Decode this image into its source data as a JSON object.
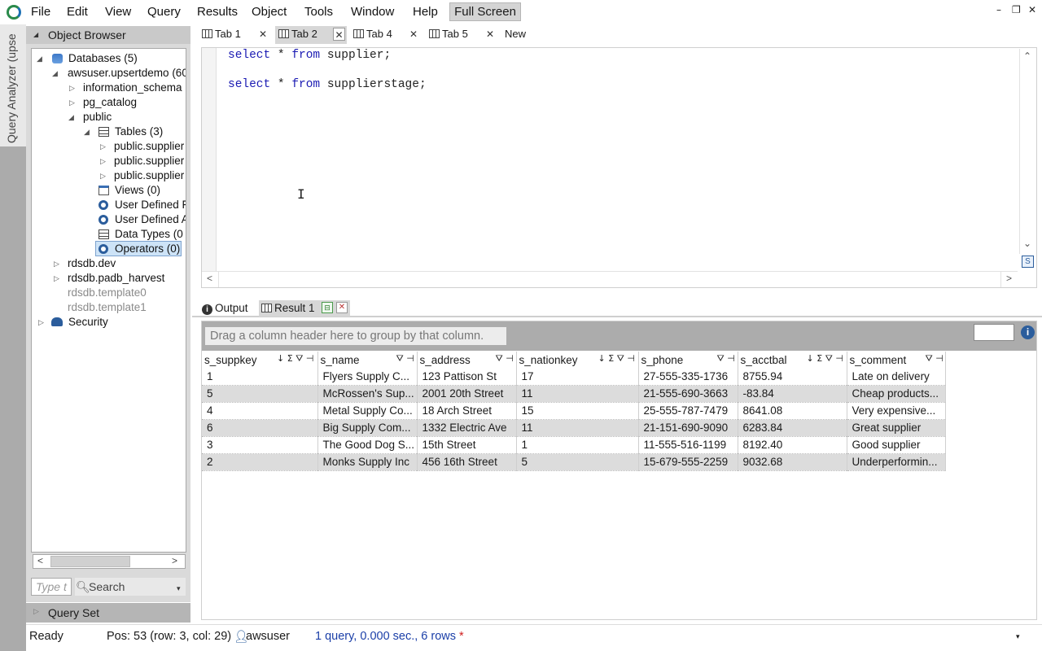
{
  "menu": [
    "File",
    "Edit",
    "View",
    "Query",
    "Results",
    "Object",
    "Tools",
    "Window",
    "Help"
  ],
  "fullscreen_label": "Full Screen",
  "rail_label": "Query Analyzer (upse",
  "object_browser": {
    "title": "Object Browser",
    "tree": {
      "databases": "Databases (5)",
      "awsuser_db": "awsuser.upsertdemo (60",
      "information_schema": "information_schema",
      "pg_catalog": "pg_catalog",
      "public": "public",
      "tables": "Tables (3)",
      "table_items": [
        "public.supplier",
        "public.supplier",
        "public.supplier"
      ],
      "views": "Views (0)",
      "udf": "User Defined F",
      "uda": "User Defined A",
      "data_types": "Data Types (0",
      "operators": "Operators (0)",
      "rdsdb_dev": "rdsdb.dev",
      "rdsdb_padb": "rdsdb.padb_harvest",
      "template0": "rdsdb.template0",
      "template1": "rdsdb.template1",
      "security": "Security"
    },
    "filter_placeholder": "Type t",
    "search_label": "Search"
  },
  "query_set_label": "Query Set",
  "tabs": [
    {
      "label": "Tab 1"
    },
    {
      "label": "Tab 2"
    },
    {
      "label": "Tab 4"
    },
    {
      "label": "Tab 5"
    },
    {
      "label": "New"
    }
  ],
  "editor": {
    "line1": {
      "kw1": "select",
      "rest1": " * ",
      "kw2": "from",
      "rest2": " supplier;"
    },
    "line3": {
      "kw1": "select",
      "rest1": " * ",
      "kw2": "from",
      "rest2": " supplierstage;"
    }
  },
  "result_tabs": {
    "output": "Output",
    "result1": "Result 1"
  },
  "group_hint": "Drag a column header here to group by that column.",
  "columns": [
    "s_suppkey",
    "s_name",
    "s_address",
    "s_nationkey",
    "s_phone",
    "s_acctbal",
    "s_comment"
  ],
  "rows": [
    [
      "1",
      "Flyers Supply C...",
      "123 Pattison St",
      "17",
      "27-555-335-1736",
      "8755.94",
      "Late on delivery"
    ],
    [
      "5",
      "McRossen's Sup...",
      "2001 20th Street",
      "11",
      "21-555-690-3663",
      "-83.84",
      "Cheap products..."
    ],
    [
      "4",
      "Metal Supply Co...",
      "18 Arch Street",
      "15",
      "25-555-787-7479",
      "8641.08",
      "Very expensive..."
    ],
    [
      "6",
      "Big Supply Com...",
      "1332 Electric Ave",
      "11",
      "21-151-690-9090",
      "6283.84",
      "Great supplier"
    ],
    [
      "3",
      "The Good Dog S...",
      "15th Street",
      "1",
      "11-555-516-1199",
      "8192.40",
      "Good supplier"
    ],
    [
      "2",
      "Monks Supply Inc",
      "456 16th Street",
      "5",
      "15-679-555-2259",
      "9032.68",
      " Underperformin..."
    ]
  ],
  "status": {
    "ready": "Ready",
    "position": "Pos: 53 (row: 3, col: 29)",
    "user": "awsuser",
    "summary": "1 query, 0.000 sec., 6 rows",
    "modified": "*"
  }
}
